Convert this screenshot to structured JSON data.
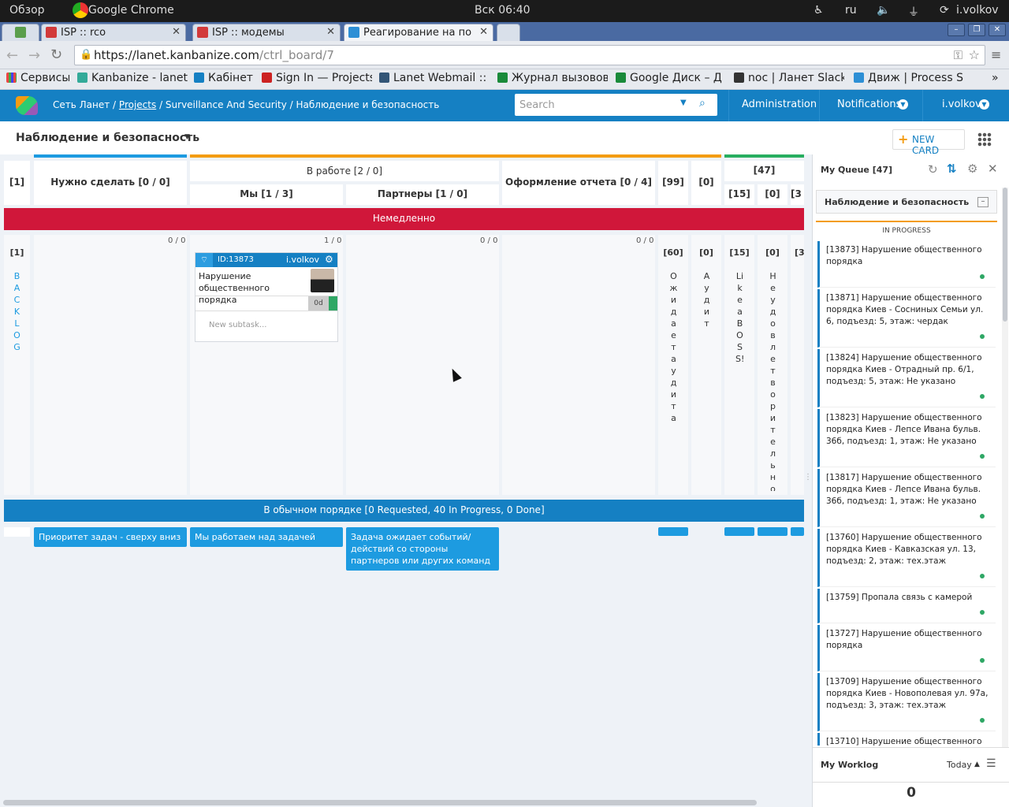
{
  "os": {
    "activities": "Обзор",
    "app": "Google Chrome",
    "clock": "Вск 06:40",
    "lang": "ru",
    "user": "i.volkov"
  },
  "tabs": [
    {
      "label": "ISP :: rco",
      "color": "#d23a3a"
    },
    {
      "label": "ISP :: модемы",
      "color": "#d23a3a"
    },
    {
      "label": "Реагирование на по",
      "color": "#2d8fd5"
    }
  ],
  "address": {
    "url_main": "https://lanet.kanbanize.com",
    "url_path": "/ctrl_board/7"
  },
  "bookmarks": [
    {
      "label": "Сервисы",
      "color": "#e44"
    },
    {
      "label": "Kanbanize - lanet",
      "color": "#3a9"
    },
    {
      "label": "Кабінет",
      "color": "#1580c3"
    },
    {
      "label": "Sign In — Projects",
      "color": "#c22"
    },
    {
      "label": "Lanet Webmail :: ",
      "color": "#357"
    },
    {
      "label": "Журнал вызовов",
      "color": "#1a8a3a"
    },
    {
      "label": "Google Диск – Д",
      "color": "#1a8a3a"
    },
    {
      "label": "noc | Ланет Slack",
      "color": "#333"
    },
    {
      "label": "Движ | Process S",
      "color": "#2d8fd5"
    }
  ],
  "header": {
    "crumb_root": "Сеть Ланет /",
    "crumb_projects": "Projects",
    "crumb_rest": "/ Surveillance And Security / Наблюдение и безопасность",
    "search_placeholder": "Search",
    "admin": "Administration",
    "notifications": "Notifications",
    "user": "i.volkov"
  },
  "board": {
    "title": "Наблюдение и безопасность",
    "new_card": "NEW CARD",
    "cols": {
      "backlog": "[1]",
      "todo": "Нужно сделать  [0 / 0]",
      "inwork": "В работе  [2 / 0]",
      "we": "Мы  [1 / 3]",
      "partners": "Партнеры  [1 / 0]",
      "report": "Оформление отчета  [0 / 4]",
      "c99": "[99]",
      "c0": "[0]",
      "c47": "[47]",
      "c15": "[15]",
      "c0b": "[0]",
      "c3": "[3"
    },
    "lane_urgent": "Немедленно",
    "lane_normal": "В обычном порядке [0 Requested, 40 In Progress, 0 Done]",
    "counts": {
      "todo": "0 / 0",
      "we": "1 / 0",
      "partners": "0 / 0",
      "report": "0 / 0"
    },
    "vcols": {
      "backlog_count": "[1]",
      "backlog": "BACKLOG",
      "wait_count": "[60]",
      "wait": "Ожидает аудита",
      "audit_count": "[0]",
      "audit": "Аудит",
      "boss_count": "[15]",
      "boss": "Like a BOSS!",
      "unsat_count": "[0]",
      "unsat": "Неудовлетворительно",
      "last_count": "[3"
    },
    "card": {
      "id": "ID:13873",
      "owner": "i.volkov",
      "title": "Нарушение общественного порядка",
      "time": "0d",
      "subtask_placeholder": "New subtask..."
    },
    "notes": [
      "Приоритет задач - сверху вниз",
      "Мы работаем над задачей",
      "Задача ожидает событий/ действий со стороны партнеров или других команд"
    ]
  },
  "queue": {
    "title": "My Queue [47]",
    "board": "Наблюдение и безопасность",
    "section": "IN PROGRESS",
    "items": [
      "[13873] Нарушение общественного порядка",
      "[13871] Нарушение общественного порядка Киев - Сосниных Семьи ул. 6, подъезд: 5, этаж: чердак",
      "[13824] Нарушение общественного порядка Киев - Отрадный пр. 6/1, подъезд: 5, этаж: Не указано",
      "[13823] Нарушение общественного порядка Киев - Лепсе Ивана бульв. 36б, подъезд: 1, этаж: Не указано",
      "[13817] Нарушение общественного порядка Киев - Лепсе Ивана бульв. 36б, подъезд: 1, этаж: Не указано",
      "[13760] Нарушение общественного порядка Киев - Кавказская ул. 13, подъезд: 2, этаж: тех.этаж",
      "[13759] Пропала связь с камерой",
      "[13727] Нарушение общественного порядка",
      "[13709] Нарушение общественного порядка Киев - Новополевая ул. 97а, подъезд: 3, этаж: тех.этаж",
      "[13710] Нарушение общественного"
    ],
    "worklog": "My Worklog",
    "today": "Today",
    "worklog_value": "0"
  }
}
